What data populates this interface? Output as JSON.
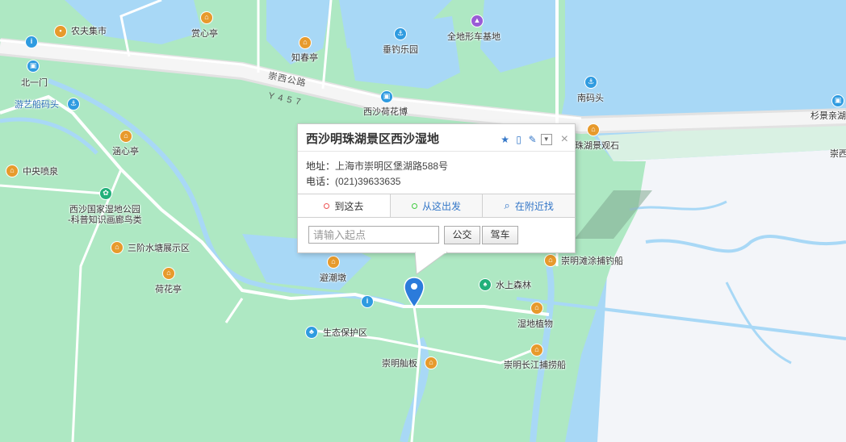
{
  "map": {
    "colors": {
      "water": "#a8d8f6",
      "land": "#aee8c3",
      "wetland": "#9fdcb8",
      "road": "#ffffff",
      "expressway": "#e9e9e9",
      "plain": "#f2f5fa"
    },
    "roads": [
      {
        "name": "崇西公路"
      },
      {
        "name": "Y 4 5 7"
      }
    ],
    "pois": [
      {
        "key": "nongfu",
        "label": "农夫集市",
        "icon": "shop-icon",
        "color": "orange"
      },
      {
        "key": "shangxin",
        "label": "赏心亭",
        "icon": "landmark-icon",
        "color": "orange"
      },
      {
        "key": "zhichun",
        "label": "知春亭",
        "icon": "landmark-icon",
        "color": "orange"
      },
      {
        "key": "chuidiao",
        "label": "垂钓乐园",
        "icon": "fishing-icon",
        "color": "blue"
      },
      {
        "key": "quandi",
        "label": "全地形车基地",
        "icon": "vehicle-icon",
        "color": "purple"
      },
      {
        "key": "beiyimen",
        "label": "北一门",
        "icon": "gate-icon",
        "color": "blue"
      },
      {
        "key": "youyi",
        "label": "游艺船码头",
        "icon": "anchor-icon",
        "color": "blue"
      },
      {
        "key": "hanxin",
        "label": "涵心亭",
        "icon": "landmark-icon",
        "color": "orange"
      },
      {
        "key": "zhongyang",
        "label": "中央喷泉",
        "icon": "landmark-icon",
        "color": "orange"
      },
      {
        "key": "shidi",
        "label": "西沙国家湿地公园\n-科普知识画廊鸟类",
        "icon": "park-icon",
        "color": "green"
      },
      {
        "key": "sanjie",
        "label": "三阶水塘展示区",
        "icon": "landmark-icon",
        "color": "orange"
      },
      {
        "key": "hehua",
        "label": "荷花亭",
        "icon": "landmark-icon",
        "color": "orange"
      },
      {
        "key": "bichao",
        "label": "避潮墩",
        "icon": "landmark-icon",
        "color": "orange"
      },
      {
        "key": "shengtai",
        "label": "生态保护区",
        "icon": "tree-icon",
        "color": "blue"
      },
      {
        "key": "shanban",
        "label": "崇明舢板",
        "icon": "landmark-icon",
        "color": "orange"
      },
      {
        "key": "shuishang",
        "label": "水上森林",
        "icon": "forest-icon",
        "color": "green"
      },
      {
        "key": "tantu",
        "label": "崇明滩涂捕钓船",
        "icon": "landmark-icon",
        "color": "orange"
      },
      {
        "key": "zhiwu",
        "label": "湿地植物",
        "icon": "landmark-icon",
        "color": "orange"
      },
      {
        "key": "changjiang",
        "label": "崇明长江捕捞船",
        "icon": "landmark-icon",
        "color": "orange"
      },
      {
        "key": "nanmatou",
        "label": "南码头",
        "icon": "anchor-icon",
        "color": "blue"
      },
      {
        "key": "guanhu",
        "label": "珠湖景观石",
        "icon": "landmark-icon",
        "color": "orange"
      },
      {
        "key": "xishahehua",
        "label": "西沙荷花博",
        "icon": "gate-icon",
        "color": "blue"
      },
      {
        "key": "shanjing",
        "label": "杉景亲湖",
        "icon": "gate-icon",
        "color": "blue"
      },
      {
        "key": "chong",
        "label": "崇西",
        "icon": "",
        "color": ""
      }
    ]
  },
  "info_window": {
    "title": "西沙明珠湖景区西沙湿地",
    "address_label": "地址：",
    "address": "上海市崇明区堡湖路588号",
    "phone_label": "电话：",
    "phone": "(021)39633635",
    "tabs": [
      "到这去",
      "从这出发",
      "在附近找"
    ],
    "start_placeholder": "请输入起点",
    "bus_button": "公交",
    "drive_button": "驾车",
    "close_glyph": "×"
  },
  "marker": {
    "color": "#2b7bdb"
  }
}
